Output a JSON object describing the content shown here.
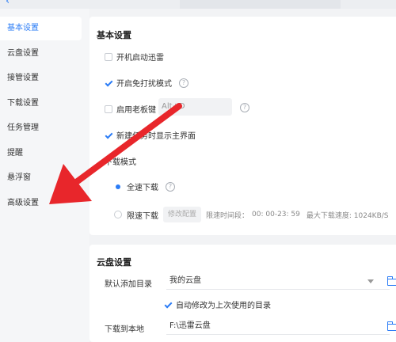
{
  "topbar": {
    "back_icon": "‹"
  },
  "sidebar": {
    "items": [
      {
        "label": "基本设置",
        "active": true
      },
      {
        "label": "云盘设置"
      },
      {
        "label": "接管设置"
      },
      {
        "label": "下载设置"
      },
      {
        "label": "任务管理"
      },
      {
        "label": "提醒"
      },
      {
        "label": "悬浮窗"
      },
      {
        "label": "高级设置"
      }
    ]
  },
  "basic": {
    "title": "基本设置",
    "autostart": "开机启动迅雷",
    "no_disturb": "开启免打扰模式",
    "boss_key": "启用老板键",
    "boss_key_value": "Alt+D",
    "show_main": "新建任务时显示主界面",
    "download_mode_title": "下载模式",
    "full_speed": "全速下载",
    "limited_speed": "限速下载",
    "edit_config": "修改配置",
    "limit_time_label": "限速时间段：",
    "limit_time_value": "00: 00-23: 59",
    "max_speed_label": "最大下载速度: 1024KB/S"
  },
  "cloud": {
    "title": "云盘设置",
    "default_dir_label": "默认添加目录",
    "default_dir_value": "我的云盘",
    "auto_modify": "自动修改为上次使用的目录",
    "download_local_label": "下载到本地",
    "download_local_value": "F:\\迅雷云盘"
  },
  "colors": {
    "accent": "#2b7cf6",
    "arrow": "#e8262b"
  },
  "icons": {
    "help": "?",
    "arrow": "red-annotation-arrow"
  }
}
